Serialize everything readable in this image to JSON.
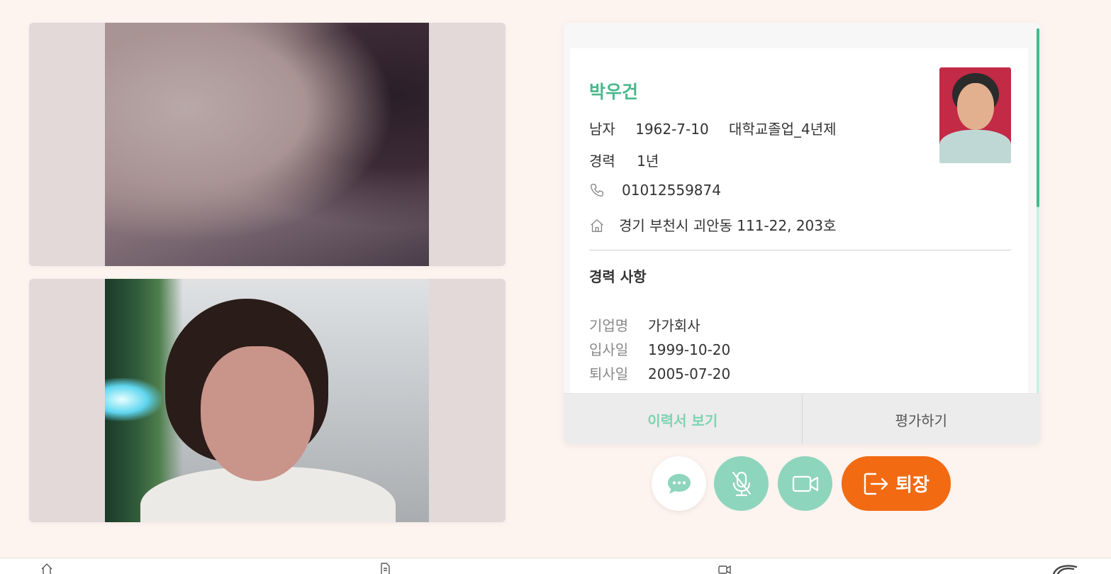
{
  "candidate": {
    "name": "박우건",
    "gender": "남자",
    "birth": "1962-7-10",
    "education": "대학교졸업_4년제",
    "experience_label": "경력",
    "experience_value": "1년",
    "phone": "01012559874",
    "address": "경기 부천시 괴안동 111-22,  203호"
  },
  "career": {
    "section_title": "경력 사항",
    "company_label": "기업명",
    "company_value": "가가회사",
    "join_label": "입사일",
    "join_value": "1999-10-20",
    "leave_label": "퇴사일",
    "leave_value": "2005-07-20"
  },
  "card_buttons": {
    "view_resume": "이력서 보기",
    "evaluate": "평가하기"
  },
  "controls": {
    "exit_label": "퇴장",
    "chat_icon": "chat-bubble-icon",
    "mic_icon": "mic-off-icon",
    "camera_icon": "video-camera-icon",
    "exit_icon": "exit-door-icon"
  },
  "colors": {
    "accent_green": "#4ab78c",
    "mint": "#8ed5bd",
    "exit_orange": "#f26a12",
    "background": "#fdf3ef"
  },
  "bottom_nav": {
    "icons": [
      "home-icon",
      "document-icon",
      "video-icon",
      "logo-icon"
    ]
  }
}
